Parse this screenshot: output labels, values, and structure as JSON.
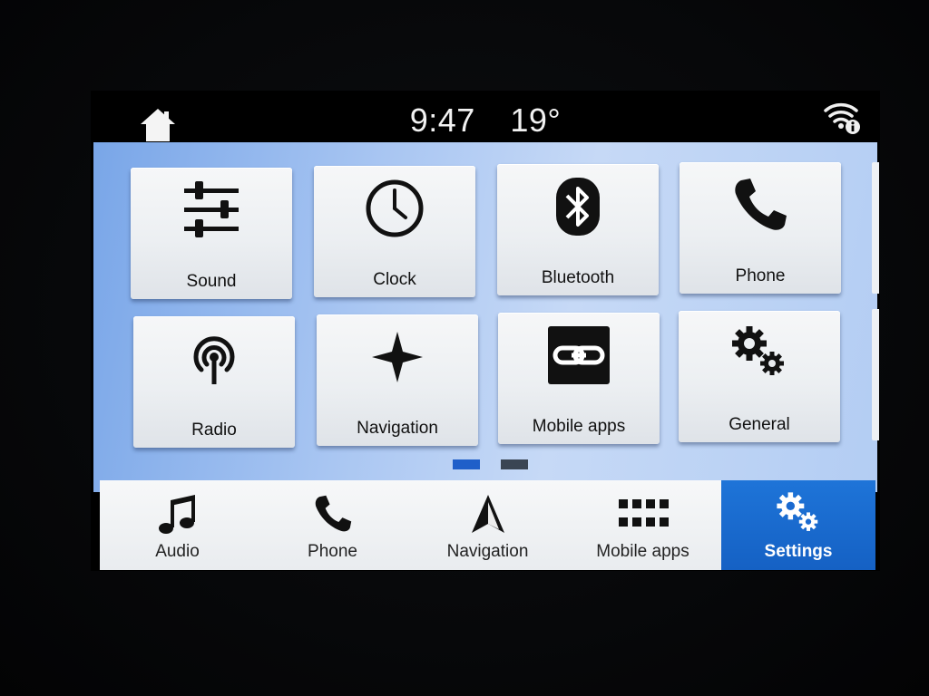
{
  "status": {
    "time": "9:47",
    "temperature": "19°"
  },
  "tiles": [
    {
      "label": "Sound",
      "icon": "sliders-icon"
    },
    {
      "label": "Clock",
      "icon": "clock-icon"
    },
    {
      "label": "Bluetooth",
      "icon": "bluetooth-icon"
    },
    {
      "label": "Phone",
      "icon": "phone-icon"
    },
    {
      "label": "Radio",
      "icon": "radio-antenna-icon"
    },
    {
      "label": "Navigation",
      "icon": "compass-star-icon"
    },
    {
      "label": "Mobile apps",
      "icon": "link-icon"
    },
    {
      "label": "General",
      "icon": "gears-icon"
    }
  ],
  "pager": {
    "pages": 2,
    "current": 1,
    "active_color": "#1f5fc9",
    "inactive_color": "#3a4553"
  },
  "bottom_nav": [
    {
      "label": "Audio",
      "icon": "music-note-icon"
    },
    {
      "label": "Phone",
      "icon": "phone-icon"
    },
    {
      "label": "Navigation",
      "icon": "navigation-arrow-icon"
    },
    {
      "label": "Mobile apps",
      "icon": "app-grid-icon"
    },
    {
      "label": "Settings",
      "icon": "gears-icon",
      "active": true
    }
  ],
  "colors": {
    "accent": "#1866cc",
    "panel_blue": "#9dbef0"
  }
}
